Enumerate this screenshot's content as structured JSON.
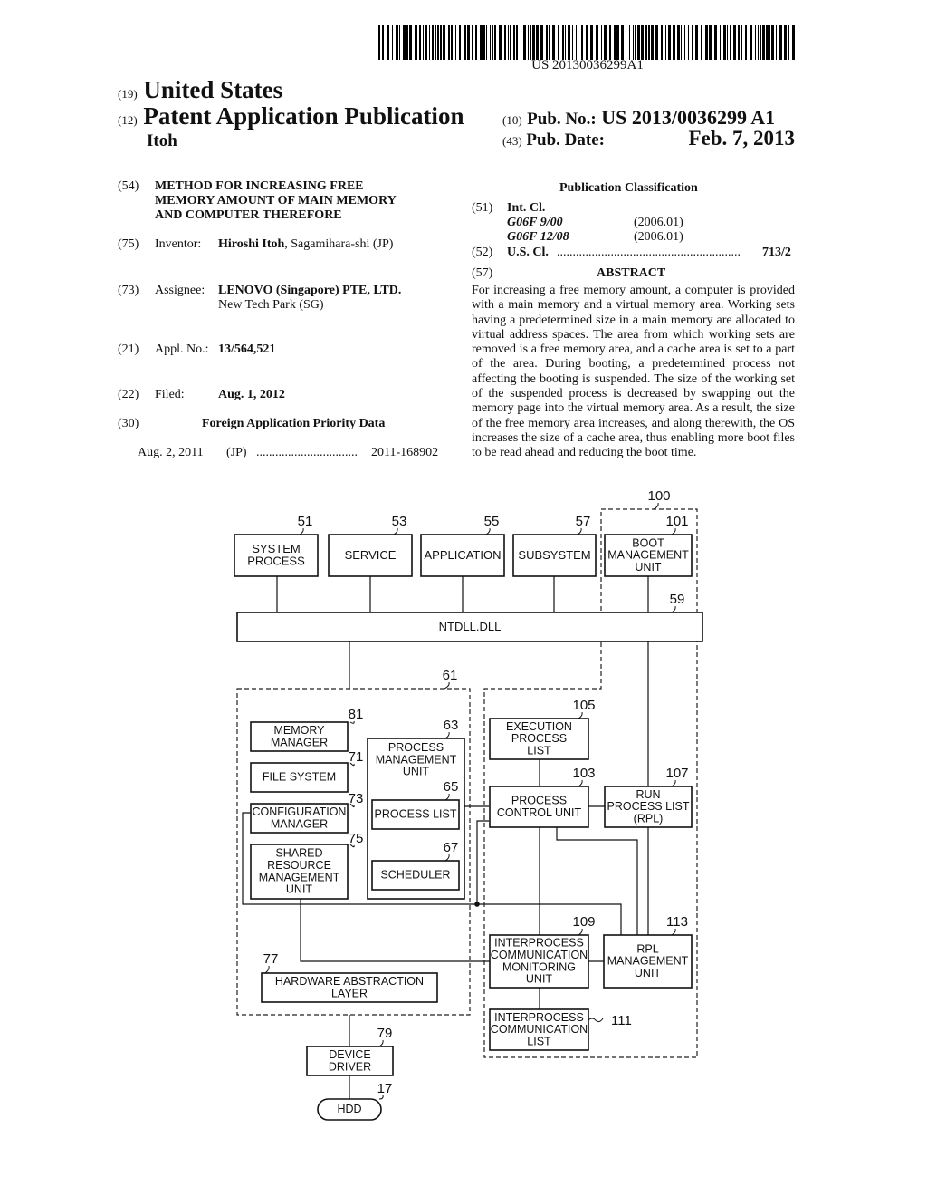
{
  "header": {
    "barcode_number": "US 20130036299A1",
    "country_code": "(19)",
    "country": "United States",
    "kind_code": "(12)",
    "publication_type": "Patent Application Publication",
    "inventor_surname": "Itoh",
    "pub_no_code": "(10)",
    "pub_no_label": "Pub. No.:",
    "pub_no": "US 2013/0036299 A1",
    "pub_date_code": "(43)",
    "pub_date_label": "Pub. Date:",
    "pub_date": "Feb. 7, 2013"
  },
  "biblio": {
    "title": {
      "code": "(54)",
      "lines": [
        "METHOD FOR INCREASING FREE",
        "MEMORY AMOUNT OF MAIN MEMORY",
        "AND COMPUTER THEREFORE"
      ]
    },
    "inventor": {
      "code": "(75)",
      "label": "Inventor:",
      "name": "Hiroshi Itoh",
      "location": ", Sagamihara-shi (JP)"
    },
    "assignee": {
      "code": "(73)",
      "label": "Assignee:",
      "name": "LENOVO (Singapore) PTE, LTD.",
      "location": "New Tech Park (SG)"
    },
    "appl_no": {
      "code": "(21)",
      "label": "Appl. No.:",
      "value": "13/564,521"
    },
    "filed": {
      "code": "(22)",
      "label": "Filed:",
      "value": "Aug. 1, 2012"
    },
    "priority": {
      "code": "(30)",
      "heading": "Foreign Application Priority Data",
      "date": "Aug. 2, 2011",
      "country": "(JP)",
      "dots": "................................",
      "number": "2011-168902"
    }
  },
  "classification": {
    "heading": "Publication Classification",
    "int_cl": {
      "code": "(51)",
      "label": "Int. Cl.",
      "entries": [
        {
          "class": "G06F 9/00",
          "version": "(2006.01)"
        },
        {
          "class": "G06F 12/08",
          "version": "(2006.01)"
        }
      ]
    },
    "us_cl": {
      "code": "(52)",
      "label": "U.S. Cl.",
      "dots": "..........................................................",
      "value": "713/2"
    }
  },
  "abstract": {
    "code": "(57)",
    "heading": "ABSTRACT",
    "text": "For increasing a free memory amount, a computer is provided with a main memory and a virtual memory area. Working sets having a predetermined size in a main memory are allocated to virtual address spaces. The area from which working sets are removed is a free memory area, and a cache area is set to a part of the area. During booting, a predetermined process not affecting the booting is suspended. The size of the working set of the suspended process is decreased by swapping out the memory page into the virtual memory area. As a result, the size of the free memory area increases, and along therewith, the OS increases the size of a cache area, thus enabling more boot files to be read ahead and reducing the boot time."
  },
  "figure": {
    "blocks": {
      "b51": {
        "ref": "51",
        "lines": [
          "SYSTEM",
          "PROCESS"
        ]
      },
      "b53": {
        "ref": "53",
        "lines": [
          "SERVICE"
        ]
      },
      "b55": {
        "ref": "55",
        "lines": [
          "APPLICATION"
        ]
      },
      "b57": {
        "ref": "57",
        "lines": [
          "SUBSYSTEM"
        ]
      },
      "b101": {
        "ref": "101",
        "lines": [
          "BOOT",
          "MANAGEMENT",
          "UNIT"
        ]
      },
      "g100": {
        "ref": "100"
      },
      "b59": {
        "ref": "59",
        "lines": [
          "NTDLL.DLL"
        ]
      },
      "g61": {
        "ref": "61"
      },
      "b81": {
        "ref": "81",
        "lines": [
          "MEMORY",
          "MANAGER"
        ]
      },
      "b71": {
        "ref": "71",
        "lines": [
          "FILE SYSTEM"
        ]
      },
      "b73": {
        "ref": "73",
        "lines": [
          "CONFIGURATION",
          "MANAGER"
        ]
      },
      "b75": {
        "ref": "75",
        "lines": [
          "SHARED",
          "RESOURCE",
          "MANAGEMENT",
          "UNIT"
        ]
      },
      "b63": {
        "ref": "63",
        "lines": [
          "PROCESS",
          "MANAGEMENT",
          "UNIT"
        ]
      },
      "b65": {
        "ref": "65",
        "lines": [
          "PROCESS LIST"
        ]
      },
      "b67": {
        "ref": "67",
        "lines": [
          "SCHEDULER"
        ]
      },
      "b77": {
        "ref": "77",
        "lines": [
          "HARDWARE ABSTRACTION",
          "LAYER"
        ]
      },
      "b105": {
        "ref": "105",
        "lines": [
          "EXECUTION",
          "PROCESS",
          "LIST"
        ]
      },
      "b103": {
        "ref": "103",
        "lines": [
          "PROCESS",
          "CONTROL UNIT"
        ]
      },
      "b107": {
        "ref": "107",
        "lines": [
          "RUN",
          "PROCESS LIST",
          "(RPL)"
        ]
      },
      "b109": {
        "ref": "109",
        "lines": [
          "INTERPROCESS",
          "COMMUNICATION",
          "MONITORING",
          "UNIT"
        ]
      },
      "b113": {
        "ref": "113",
        "lines": [
          "RPL",
          "MANAGEMENT",
          "UNIT"
        ]
      },
      "b111": {
        "ref": "111",
        "lines": [
          "INTERPROCESS",
          "COMMUNICATION",
          "LIST"
        ]
      },
      "b79": {
        "ref": "79",
        "lines": [
          "DEVICE",
          "DRIVER"
        ]
      },
      "b17": {
        "ref": "17",
        "lines": [
          "HDD"
        ]
      }
    }
  }
}
